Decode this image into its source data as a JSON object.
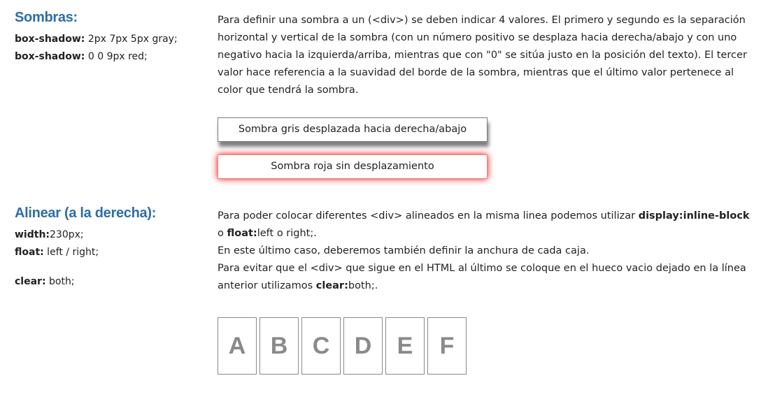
{
  "sombras": {
    "title": "Sombras:",
    "code_lines": [
      {
        "prop": "box-shadow:",
        "value": " 2px 7px 5px gray;"
      },
      {
        "prop": "box-shadow:",
        "value": " 0 0 9px red;"
      }
    ],
    "paragraph": "Para definir una sombra a un (<div>) se deben indicar 4 valores. El primero y segundo es la separación horizontal y vertical de la sombra (con un número positivo se desplaza hacia derecha/abajo y con uno negativo hacia la izquierda/arriba, mientras que con \"0\" se sitúa justo en la posición del texto). El tercer valor hace referencia a la suavidad del borde de la sombra, mientras que el último valor pertenece al color que tendrá la sombra.",
    "demo_gray": "Sombra gris desplazada hacia derecha/abajo",
    "demo_red": "Sombra roja sin desplazamiento"
  },
  "alinear": {
    "title": "Alinear (a la derecha):",
    "code_lines": [
      {
        "prop": "width:",
        "value": "230px;"
      },
      {
        "prop": "float:",
        "value": " left / right;"
      },
      {
        "prop": "clear:",
        "value": " both;"
      }
    ],
    "p1_a": "Para poder colocar diferentes <div> alineados en la misma linea podemos utilizar ",
    "p1_b1": "display:inline-block",
    "p1_c": " o ",
    "p1_b2": "float:",
    "p1_d": "left o right;.",
    "p2": "En este último caso, deberemos también definir la anchura de cada caja.",
    "p3_a": "Para evitar que el <div> que sigue en el HTML al último se coloque en el hueco vacio dejado en la línea anterior utilizamos ",
    "p3_b": "clear:",
    "p3_c": "both;.",
    "boxes": [
      "A",
      "B",
      "C",
      "D",
      "E",
      "F"
    ]
  },
  "colors": {
    "title": "#2d6da6",
    "shadow_gray": "gray",
    "shadow_red": "red"
  }
}
